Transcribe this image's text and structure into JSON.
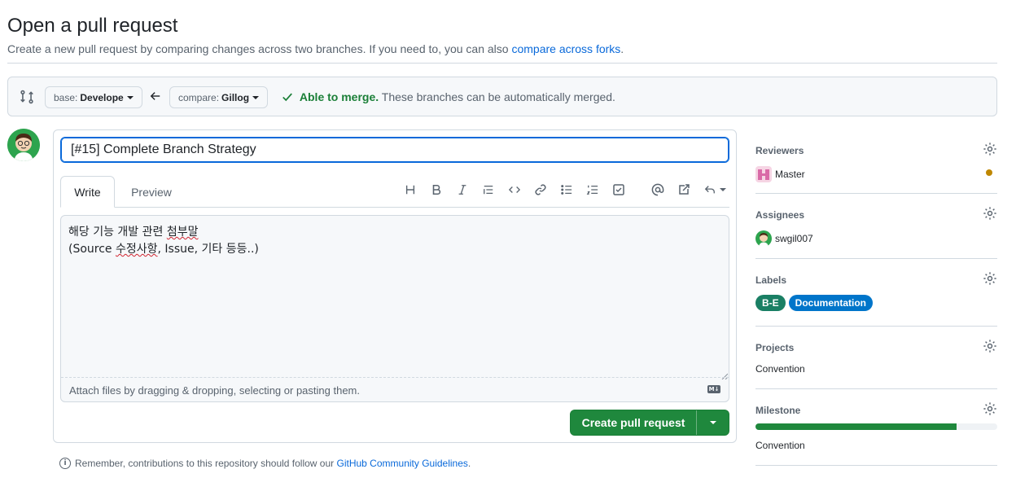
{
  "header": {
    "title": "Open a pull request",
    "subtitle": "Create a new pull request by comparing changes across two branches. If you need to, you can also",
    "subtitle_link": "compare across forks",
    "subtitle_end": "."
  },
  "compare": {
    "base_prefix": "base:",
    "base_branch": "Develope",
    "compare_prefix": "compare:",
    "compare_branch": "Gillog",
    "merge_status": "Able to merge.",
    "merge_message": "These branches can be automatically merged."
  },
  "form": {
    "title_value": "[#15] Complete Branch Strategy",
    "tabs": {
      "write": "Write",
      "preview": "Preview"
    },
    "toolbar_icons": [
      "heading-icon",
      "bold-icon",
      "italic-icon",
      "quote-icon",
      "code-icon",
      "link-icon",
      "unordered-list-icon",
      "ordered-list-icon",
      "task-list-icon",
      "mention-icon",
      "reference-icon",
      "reply-icon"
    ],
    "body_line1_a": "해당 기능 개발 관련 ",
    "body_line1_b": "첨부말",
    "body_line2_a": "(Source ",
    "body_line2_b": "수정사항",
    "body_line2_c": ", Issue, 기타 등등..)",
    "attach_hint": "Attach files by dragging & dropping, selecting or pasting them.",
    "markdown_badge": "M↓",
    "create_button": "Create pull request"
  },
  "footer": {
    "remember": "Remember, contributions to this repository should follow our",
    "guidelines_link": "GitHub Community Guidelines",
    "end": "."
  },
  "sidebar": {
    "reviewers": {
      "heading": "Reviewers",
      "name": "Master",
      "pending_color": "#bf8700"
    },
    "assignees": {
      "heading": "Assignees",
      "name": "swgil007"
    },
    "labels": {
      "heading": "Labels",
      "items": [
        {
          "name": "B-E",
          "color": "#1a7f64"
        },
        {
          "name": "Documentation",
          "color": "#0075ca"
        }
      ]
    },
    "projects": {
      "heading": "Projects",
      "value": "Convention"
    },
    "milestone": {
      "heading": "Milestone",
      "value": "Convention",
      "progress": 0.83
    }
  },
  "colors": {
    "accent": "#0969da",
    "success": "#1f883d"
  }
}
